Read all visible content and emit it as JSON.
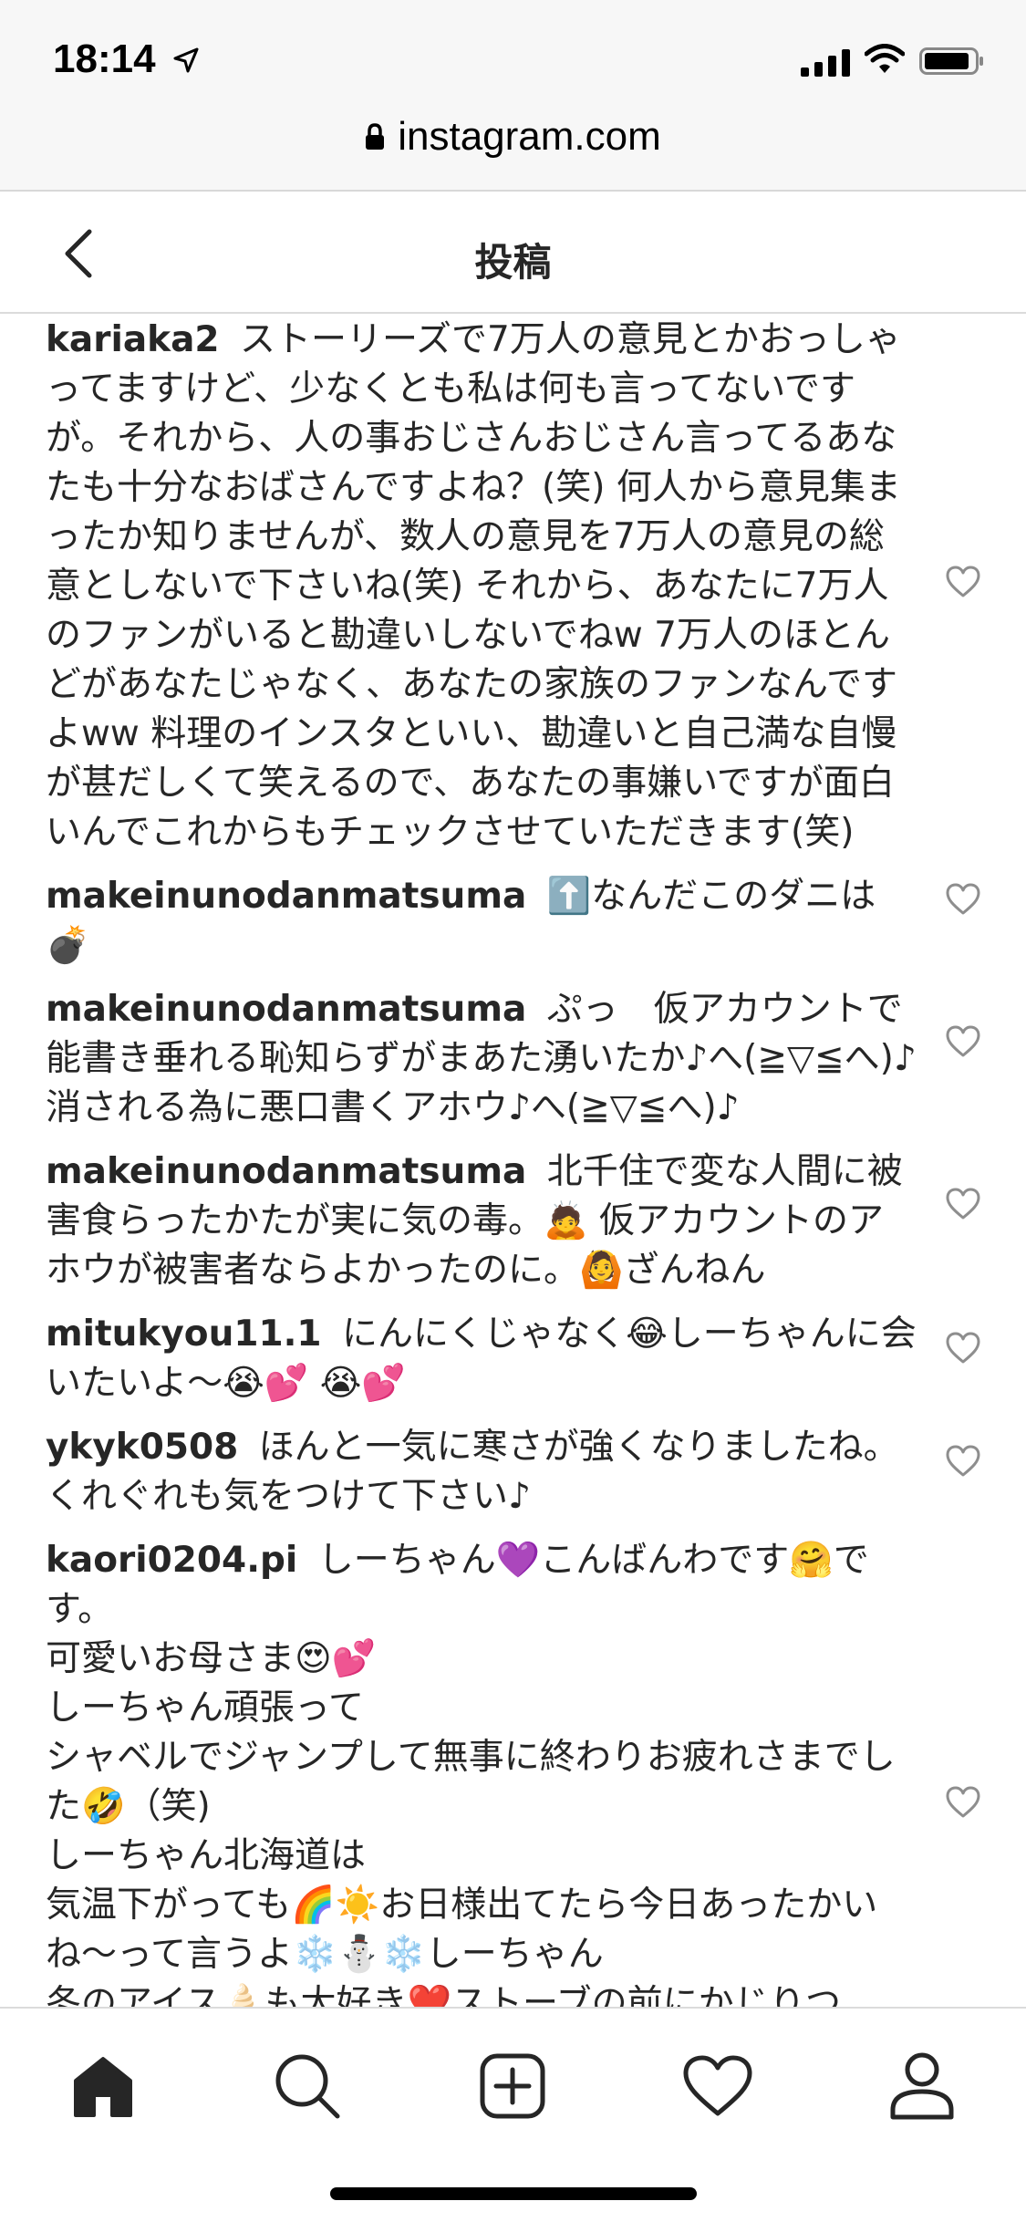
{
  "status": {
    "time": "18:14"
  },
  "browser": {
    "url": "instagram.com"
  },
  "header": {
    "title": "投稿"
  },
  "comments": [
    {
      "user": "kariaka2",
      "text": "ストーリーズで7万人の意見とかおっしゃってますけど、少なくとも私は何も言ってないですが。それから、人の事おじさんおじさん言ってるあなたも十分なおばさんですよね？(笑) 何人から意見集まったか知りませんが、数人の意見を7万人の意見の総意としないで下さいね(笑) それから、あなたに7万人のファンがいると勘違いしないでねw 7万人のほとんどがあなたじゃなく、あなたの家族のファンなんですよww 料理のインスタといい、勘違いと自己満な自慢が甚だしくて笑えるので、あなたの事嫌いですが面白いんでこれからもチェックさせていただきます(笑)"
    },
    {
      "user": "makeinunodanmatsuma",
      "text": "⬆️なんだこのダニは💣"
    },
    {
      "user": "makeinunodanmatsuma",
      "text": "ぷっ　仮アカウントで能書き垂れる恥知らずがまあた湧いたか♪へ(≧▽≦へ)♪消される為に悪口書くアホウ♪へ(≧▽≦へ)♪"
    },
    {
      "user": "makeinunodanmatsuma",
      "text": "北千住で変な人間に被害食らったかたが実に気の毒。🙇 仮アカウントのアホウが被害者ならよかったのに。🙆ざんねん"
    },
    {
      "user": "mitukyou11.1",
      "text": "にんにくじゃなく😂しーちゃんに会いたいよ〜😭💕 😭💕"
    },
    {
      "user": "ykyk0508",
      "text": "ほんと一気に寒さが強くなりましたね。くれぐれも気をつけて下さい♪"
    },
    {
      "user": "kaori0204.pi",
      "text": "しーちゃん💜こんばんわです🤗です。\n可愛いお母さま😍💕\nしーちゃん頑張って\nシャベルでジャンプして無事に終わりお疲れさまでした🤣（笑)\nしーちゃん北海道は\n気温下がっても🌈☀️お日様出てたら今日あったかいね〜って言うよ❄️⛄❄️しーちゃん\n冬のアイス🍦も大好き❤️ストーブの前にかじりつ"
    }
  ],
  "tabbar": {
    "items": [
      "home-icon",
      "search-icon",
      "new-post-icon",
      "activity-heart-icon",
      "profile-icon"
    ]
  }
}
